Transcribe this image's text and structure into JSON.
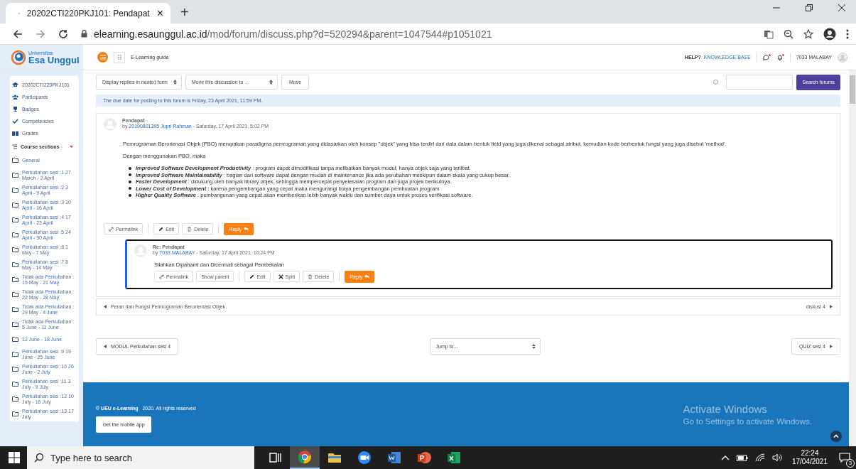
{
  "browser": {
    "tab_title": "20202CTI220PKJ101: Pendapat",
    "tab_close": "×",
    "new_tab": "+",
    "url_domain": "elearning.esaunggul.ac.id",
    "url_path": "/mod/forum/discuss.php?d=520294&parent=1047544#p1051021"
  },
  "logo": {
    "small": "Universitas",
    "name": "Esa Unggul"
  },
  "header": {
    "guide": "E-Learning guide",
    "help": "HELP?",
    "knowledge": "KNOWLEDGE BASE",
    "user": "7033 MALABAY"
  },
  "sidebar": {
    "items": [
      "20202CTI220PKJ101",
      "Participants",
      "Badges",
      "Competencies",
      "Grades"
    ],
    "sections_title": "Course sections",
    "sections": [
      "General",
      "Perkuliahan sesi :1 27 March - 2 April",
      "Perkuliahan sesi :2 3 April - 9 April",
      "Perkuliahan sesi :3 10 April - 16 April",
      "Perkuliahan sesi :4 17 April - 23 April",
      "Perkuliahan sesi :5 24 April - 30 April",
      "Perkuliahan sesi :6 1 May - 7 May",
      "Perkuliahan sesi :7 8 May - 14 May",
      "Tidak ada Perkuliahan : 15 May - 21 May",
      "Tidak ada Perkuliahan : 22 May - 28 May",
      "Tidak ada Perkuliahan : 29 May - 4 June",
      "Tidak ada Perkuliahan : 5 June - 11 June",
      "12 June - 18 June",
      "Perkuliahan sesi :9 19 June - 25 June",
      "Perkuliahan sesi :10 26 June - 2 July",
      "Perkuliahan sesi :11 3 July - 9 July",
      "Perkuliahan sesi :12 10 July - 16 July",
      "Perkuliahan sesi :13 17 July"
    ]
  },
  "toolbar": {
    "display_select": "Display replies in nested form",
    "move_select": "Move this discussion to ...",
    "move_button": "Move",
    "search_button": "Search forums"
  },
  "notice": "The due date for posting to this forum is Friday, 23 April 2021, 11:59 PM.",
  "post": {
    "title": "Pendapat",
    "by": "by",
    "author": "20190801395 Jupri Rahman",
    "date": "- Saturday, 17 April 2021, 5:02 PM",
    "paragraphs": [
      "Pemrograman Berorienasi Objek (PBO) merupakan paradigma pemrograman yang didasarkan oleh konsep \"objek\" yang bisa terdiri dari data dalam bentuk field yang juga dikenal sebagai atribut, kemudian kode berbentuk fungsi yang juga disebut 'method'.",
      "Dengan menggunakan PBO, maka"
    ],
    "list": [
      {
        "term": "Improved Software Development Productivity",
        "text": " : program dapat dimodifikasi tanpa melibatkan banyak modul, hanya objek saja yang terlibat."
      },
      {
        "term": "Improved Software Maintainability",
        "text": " : bagian dari software dapat dengan mudah di maintenance jika ada perubahan meskipun dalam skala yang cukup besar."
      },
      {
        "term": "Faster Development",
        "text": " : didukung oleh banyak library objek, sehingga mempercepat penyelesaian program dan juga projek berikutnya."
      },
      {
        "term": "Lower Cost of Development",
        "text": " : karena pengembangan yang cepat maka mengurangi biaya pengembangan pembuatan program"
      },
      {
        "term": "Higher Quality Software",
        "text": " : pembangunan yang cepat akan memberikan lebih banyak waktu dan sumber daya untuk proses verifikasi software."
      }
    ],
    "actions": [
      {
        "kind": "permalink",
        "label": "Permalink"
      },
      {
        "kind": "edit",
        "label": "Edit"
      },
      {
        "kind": "delete",
        "label": "Delete"
      }
    ],
    "reply": "Reply"
  },
  "reply": {
    "title": "Re: Pendapat",
    "by": "by",
    "author": "7033 MALABAY",
    "date": "- Saturday, 17 April 2021, 10:24 PM",
    "body": "Silahkan Dipahami dan Dicermati sebagai Pembekalan",
    "actions": [
      {
        "kind": "permalink",
        "label": "Permalink"
      },
      {
        "kind": "show_parent",
        "label": "Show parent"
      },
      {
        "kind": "edit",
        "label": "Edit"
      },
      {
        "kind": "split",
        "label": "Split"
      },
      {
        "kind": "delete",
        "label": "Delete"
      }
    ],
    "reply": "Reply"
  },
  "discussion_nav": {
    "prev": "Peran dan Fungsi Pemrograman Berorientasi Objek",
    "next": "diskusi 4"
  },
  "activity_nav": {
    "prev": "MODUL Perkuliahan sesi 4",
    "jump": "Jump to...",
    "next": "QUIZ sesi 4"
  },
  "footer": {
    "brand": "© UEU e-Learning",
    "rights": "2020. All rights reserved",
    "app_button": "Get the mobile app"
  },
  "activation": {
    "title": "Activate Windows",
    "text": "Go to Settings to activate Windows."
  },
  "taskbar": {
    "search": "Type here to search",
    "apps": [
      {
        "kind": "taskview",
        "active": false
      },
      {
        "kind": "chrome",
        "active": true
      },
      {
        "kind": "explorer",
        "active": false
      },
      {
        "kind": "zoom",
        "active": false
      },
      {
        "kind": "word",
        "active": false
      },
      {
        "kind": "powerpoint",
        "active": false
      },
      {
        "kind": "excel",
        "active": false
      }
    ],
    "time": "22:24",
    "date": "17/04/2021",
    "notifications": "3"
  }
}
